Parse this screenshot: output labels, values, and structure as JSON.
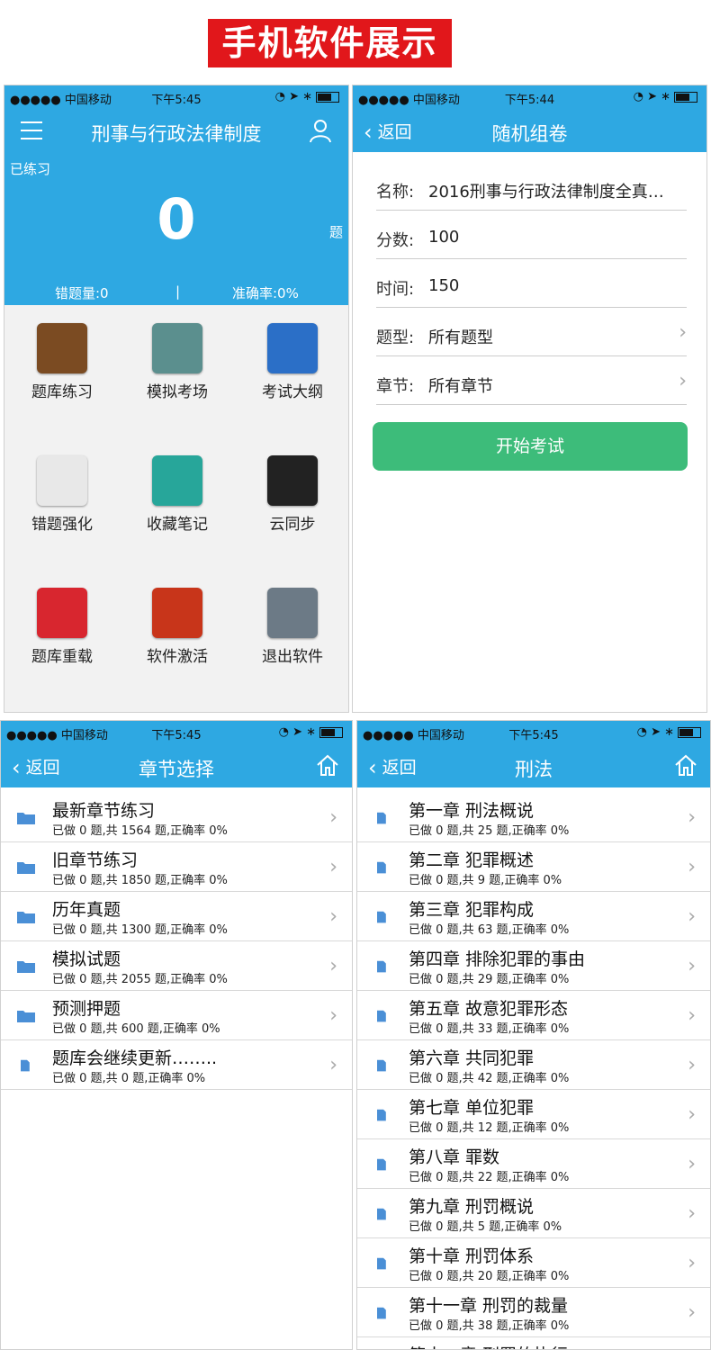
{
  "banner": "手机软件展示",
  "status": {
    "carrier": "●●●●● 中国移动",
    "time1": "下午5:45",
    "time2": "下午5:44",
    "time3": "下午5:45",
    "time4": "下午5:45"
  },
  "home": {
    "title": "刑事与行政法律制度",
    "practiced_label": "已练习",
    "practiced_count": "0",
    "unit": "题",
    "wrong": "错题量:0",
    "sep": "|",
    "accuracy": "准确率:0%",
    "tiles": [
      {
        "label": "题库练习",
        "icon": "book-icon",
        "color": "#7b4b22"
      },
      {
        "label": "模拟考场",
        "icon": "clock-icon",
        "color": "#5b8f8e"
      },
      {
        "label": "考试大纲",
        "icon": "compass-icon",
        "color": "#2b6fc7"
      },
      {
        "label": "错题强化",
        "icon": "sun-icon",
        "color": "#e8e8e8"
      },
      {
        "label": "收藏笔记",
        "icon": "note-icon",
        "color": "#27a69a"
      },
      {
        "label": "云同步",
        "icon": "hexagon-icon",
        "color": "#222222"
      },
      {
        "label": "题库重载",
        "icon": "reload-icon",
        "color": "#d8262f"
      },
      {
        "label": "软件激活",
        "icon": "flame-icon",
        "color": "#c8351a"
      },
      {
        "label": "退出软件",
        "icon": "phone-icon",
        "color": "#6c7a86"
      }
    ]
  },
  "exam": {
    "back": "返回",
    "title": "随机组卷",
    "fields": [
      {
        "key": "名称:",
        "value": "2016刑事与行政法律制度全真…"
      },
      {
        "key": "分数:",
        "value": "100"
      },
      {
        "key": "时间:",
        "value": "150"
      },
      {
        "key": "题型:",
        "value": "所有题型",
        "arrow": "›"
      },
      {
        "key": "章节:",
        "value": "所有章节",
        "arrow": "›"
      }
    ],
    "start": "开始考试"
  },
  "chapters": {
    "back": "返回",
    "title": "章节选择",
    "rows": [
      {
        "title": "最新章节练习",
        "sub": "已做 0 题,共 1564 题,正确率 0%",
        "type": "folder"
      },
      {
        "title": "旧章节练习",
        "sub": "已做 0 题,共 1850 题,正确率 0%",
        "type": "folder"
      },
      {
        "title": "历年真题",
        "sub": "已做 0 题,共 1300 题,正确率 0%",
        "type": "folder"
      },
      {
        "title": "模拟试题",
        "sub": "已做 0 题,共 2055 题,正确率 0%",
        "type": "folder"
      },
      {
        "title": "预测押题",
        "sub": "已做 0 题,共 600 题,正确率 0%",
        "type": "folder"
      },
      {
        "title": "题库会继续更新……..",
        "sub": "已做 0 题,共 0 题,正确率 0%",
        "type": "doc"
      }
    ]
  },
  "criminal": {
    "back": "返回",
    "title": "刑法",
    "rows": [
      {
        "title": "第一章 刑法概说",
        "sub": "已做 0 题,共 25 题,正确率 0%"
      },
      {
        "title": "第二章 犯罪概述",
        "sub": "已做 0 题,共 9 题,正确率 0%"
      },
      {
        "title": "第三章 犯罪构成",
        "sub": "已做 0 题,共 63 题,正确率 0%"
      },
      {
        "title": "第四章 排除犯罪的事由",
        "sub": "已做 0 题,共 29 题,正确率 0%"
      },
      {
        "title": "第五章 故意犯罪形态",
        "sub": "已做 0 题,共 33 题,正确率 0%"
      },
      {
        "title": "第六章 共同犯罪",
        "sub": "已做 0 题,共 42 题,正确率 0%"
      },
      {
        "title": "第七章 单位犯罪",
        "sub": "已做 0 题,共 12 题,正确率 0%"
      },
      {
        "title": "第八章 罪数",
        "sub": "已做 0 题,共 22 题,正确率 0%"
      },
      {
        "title": "第九章 刑罚概说",
        "sub": "已做 0 题,共 5 题,正确率 0%"
      },
      {
        "title": "第十章 刑罚体系",
        "sub": "已做 0 题,共 20 题,正确率 0%"
      },
      {
        "title": "第十一章 刑罚的裁量",
        "sub": "已做 0 题,共 38 题,正确率 0%"
      },
      {
        "title": "第十二章 刑罚的执行",
        "sub": ""
      }
    ]
  },
  "colors": {
    "primary": "#2ea8e2",
    "start": "#3dbc7a",
    "banner": "#e1171b",
    "folder": "#4a8fd6"
  }
}
